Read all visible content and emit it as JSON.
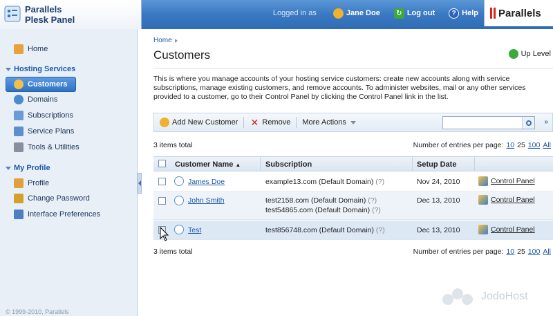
{
  "header": {
    "logo_line1": "Parallels",
    "logo_line2": "Plesk Panel",
    "logged_in_as": "Logged in as",
    "user_name": "Jane Doe",
    "logout": "Log out",
    "help": "Help",
    "brand": "Parallels"
  },
  "sidebar": {
    "home": "Home",
    "hosting_heading": "Hosting Services",
    "hosting_items": [
      "Customers",
      "Domains",
      "Subscriptions",
      "Service Plans",
      "Tools & Utilities"
    ],
    "profile_heading": "My Profile",
    "profile_items": [
      "Profile",
      "Change Password",
      "Interface Preferences"
    ],
    "copyright": "© 1999-2010, Parallels"
  },
  "main": {
    "breadcrumb": "Home",
    "title": "Customers",
    "up_level": "Up Level",
    "description": "This is where you manage accounts of your hosting service customers: create new accounts along with service subscriptions, manage existing customers, and remove accounts. To administer websites, mail or any other services provided to a customer, go to their Control Panel by clicking the Control Panel link in the list.",
    "toolbar": {
      "add": "Add New Customer",
      "remove": "Remove",
      "more": "More Actions",
      "search_placeholder": ""
    },
    "total": "3 items total",
    "per_page_label": "Number of entries per page:",
    "per_page_options": [
      "10",
      "25",
      "100",
      "All"
    ],
    "columns": [
      "Customer Name",
      "Subscription",
      "Setup Date"
    ],
    "rows": [
      {
        "name": "James Doe",
        "subs": [
          "example13.com (Default Domain)"
        ],
        "date": "Nov 24, 2010",
        "cp": "Control Panel"
      },
      {
        "name": "John Smith",
        "subs": [
          "test2158.com (Default Domain)",
          "test54865.com (Default Domain)"
        ],
        "date": "Dec 13, 2010",
        "cp": "Control Panel"
      },
      {
        "name": "Test",
        "subs": [
          "test856748.com (Default Domain)"
        ],
        "date": "Dec 13, 2010",
        "cp": "Control Panel"
      }
    ],
    "qmark": "(?)",
    "sort_arrow": "▲",
    "more_toggle": "»"
  },
  "watermark": "JodoHost",
  "colors": {
    "header_blue": "#3a78c2",
    "sidebar_bg": "#e8eff7",
    "link": "#1d5aa8",
    "active": "#2f73c5"
  }
}
